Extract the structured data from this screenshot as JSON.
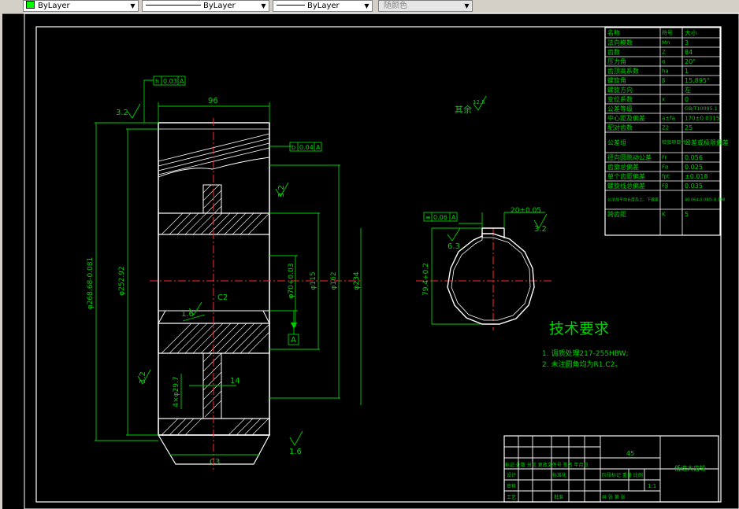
{
  "toolbar": {
    "color_control": "ByLayer",
    "linetype_control": "ByLayer",
    "lineweight_control": "ByLayer",
    "plotstyle_control": "随颜色"
  },
  "drawing": {
    "dims": {
      "width_96": "96",
      "dia_outer": "φ268.68-0.081",
      "dia_root": "φ252.92",
      "dia_hub_outer": "φ162",
      "dia_bore": "φ70+0.03",
      "dia_hub": "φ115",
      "dia_web": "φ234",
      "hole_spec": "4×φ29.7",
      "web_width": "14",
      "keyway_width": "20±0.05",
      "keyway_depth": "79.4+0.2",
      "chamfer_c2": "C2",
      "chamfer_c3": "C3"
    },
    "roughness": {
      "r1": "3.2",
      "r2": "3.2",
      "r3": "3.2",
      "r4": "1.6",
      "r5": "1.6",
      "r6": "6.3",
      "r7": "3.2",
      "others": "其余",
      "others_val": "12.5"
    },
    "tolerances": {
      "t1_sym": "h",
      "t1_val": "0.03",
      "t1_ref": "A",
      "t2_sym": "b",
      "t2_val": "0.04",
      "t2_ref": "A",
      "t3_sym": "≡",
      "t3_val": "0.06",
      "t3_ref": "A",
      "datum": "A"
    },
    "tech_req": {
      "title": "技术要求",
      "item1": "1. 调质处理217-255HBW;",
      "item2": "2. 未注圆角均为R1.C2。"
    },
    "gear_table": [
      {
        "label": "名称",
        "sym": "符号",
        "val": "大小"
      },
      {
        "label": "法向模数",
        "sym": "Mn",
        "val": "3"
      },
      {
        "label": "齿数",
        "sym": "Z",
        "val": "84"
      },
      {
        "label": "压力角",
        "sym": "α",
        "val": "20°"
      },
      {
        "label": "齿顶高系数",
        "sym": "ha",
        "val": "1"
      },
      {
        "label": "螺旋角",
        "sym": "β",
        "val": "15.895°"
      },
      {
        "label": "螺旋方向",
        "sym": "",
        "val": "左"
      },
      {
        "label": "变位系数",
        "sym": "x",
        "val": "0"
      },
      {
        "label": "公差等级",
        "sym": "",
        "val": "GB/T10095.1"
      },
      {
        "label": "中心距及偏差",
        "sym": "a±fa",
        "val": "170±0.0315"
      },
      {
        "label": "配对齿数",
        "sym": "Z2",
        "val": "25"
      },
      {
        "label": "公差组",
        "sym": "检验项目代号",
        "val": "公差或极限偏差"
      },
      {
        "label": "径向圆跳动公差",
        "sym": "Fr",
        "val": "0.056"
      },
      {
        "label": "齿廓总偏差",
        "sym": "Fα",
        "val": "0.025"
      },
      {
        "label": "单个齿距偏差",
        "sym": "fpt",
        "val": "±0.018"
      },
      {
        "label": "螺旋线总偏差",
        "sym": "Fβ",
        "val": "0.035"
      },
      {
        "label": "公法线平均长度及上、下偏差",
        "sym": "",
        "val": "40.064-0.080/-0.198"
      },
      {
        "label": "跨齿距",
        "sym": "K",
        "val": "5"
      }
    ],
    "title_block": {
      "material": "45",
      "part_name": "低速大齿轮",
      "scale": "1:1",
      "row1": "标记 处数 分区 更改文件号 签名 年月日",
      "design": "设计",
      "standard": "标准化",
      "review": "审核",
      "process": "工艺",
      "approve": "批准",
      "stage": "阶段标记 重量 比例",
      "sheet": "共 张 第 张"
    }
  }
}
